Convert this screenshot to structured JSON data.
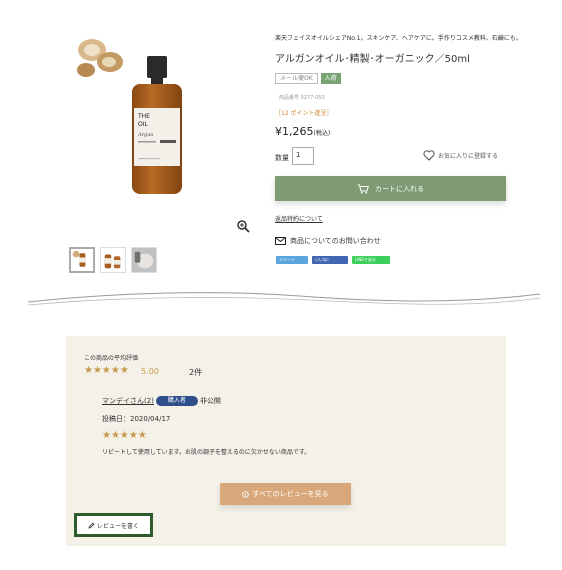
{
  "product": {
    "shop_description": "楽天フェイスオイルシェアNo.1。スキンケア、ヘアケアに。手作りコスメ教科、石鹸にも。",
    "title": "アルガンオイル･精製･オーガニック／50ml",
    "badges": {
      "mail": "メール便OK",
      "stock": "入荷"
    },
    "code": "商品番号 0277-050",
    "points": "［12 ポイント進呈］",
    "price": "¥1,265",
    "tax_label": "(税込)",
    "quantity_label": "数量",
    "quantity_value": "1",
    "favorite_label": "お気に入りに登録する",
    "cart_button": "カートに入れる",
    "returns_link": "返品特約について",
    "inquiry_link": "商品についてのお問い合わせ",
    "social": {
      "tweet": "ツイート",
      "like": "いいね！",
      "line": "LINEで送る"
    },
    "bottle_label": {
      "brand_line1": "THE",
      "brand_line2": "OIL",
      "variant": "Argan"
    }
  },
  "reviews": {
    "average_label": "この商品の平均評価",
    "average_stars": "★★★★★",
    "average_score": "5.00",
    "count": "2件",
    "items": [
      {
        "name": "マンデイさん(2)",
        "badge": "購入者",
        "visibility": "非公開",
        "posted": "投稿日：2020/04/17",
        "stars": "★★★★★",
        "text": "リピートして使用しています。お肌の調子を整えるのに欠かせない商品です。"
      }
    ],
    "all_reviews_button": "すべてのレビューを見る",
    "write_review_button": "レビューを書く"
  },
  "colors": {
    "cart_green": "#7e9b74",
    "stock_green": "#7aa374",
    "review_bg": "#f4f1e9",
    "all_reviews_tan": "#d8a87a",
    "star_gold": "#c69a4a",
    "buyer_badge": "#2f4f8a",
    "highlight_border": "#2d5c2d"
  },
  "icons": [
    "zoom-icon",
    "heart-icon",
    "cart-icon",
    "mail-icon",
    "chat-icon",
    "pencil-icon"
  ]
}
